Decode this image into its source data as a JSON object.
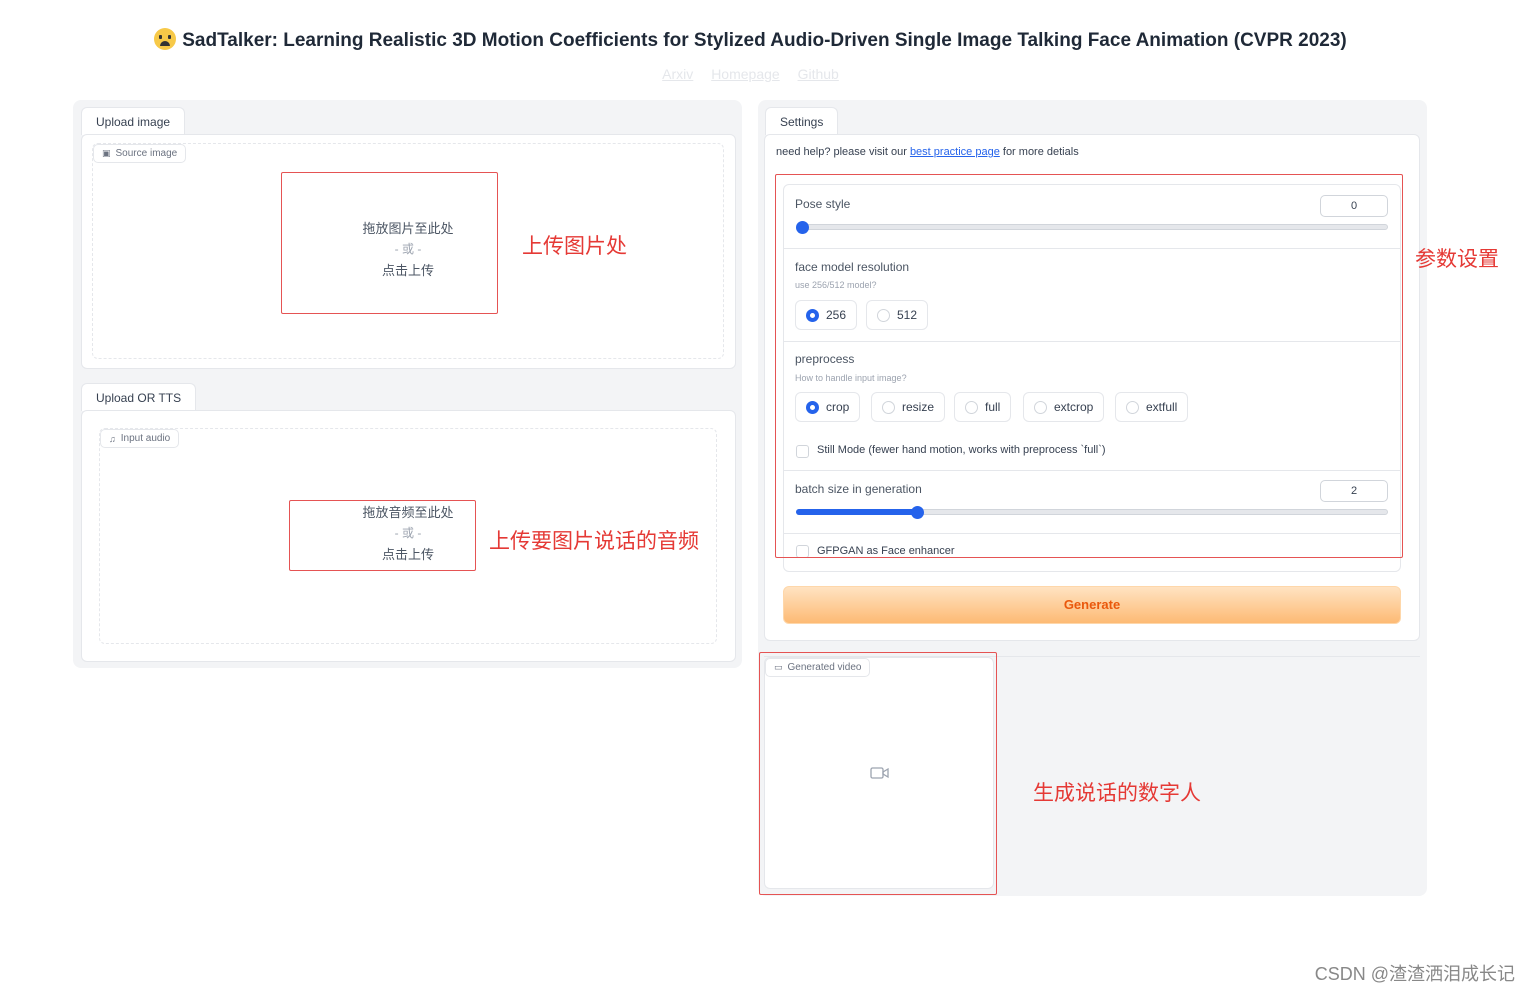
{
  "header": {
    "title": "SadTalker: Learning Realistic 3D Motion Coefficients for Stylized Audio-Driven Single Image Talking Face Animation (CVPR 2023)",
    "links": [
      "Arxiv",
      "Homepage",
      "Github"
    ]
  },
  "upload_image": {
    "tab": "Upload image",
    "chip": "Source image",
    "drop_line1": "拖放图片至此处",
    "drop_or": "- 或 -",
    "drop_line2": "点击上传"
  },
  "upload_audio": {
    "tab": "Upload OR TTS",
    "chip": "Input audio",
    "drop_line1": "拖放音频至此处",
    "drop_or": "- 或 -",
    "drop_line2": "点击上传"
  },
  "settings": {
    "tab": "Settings",
    "help_prefix": "need help? please visit our ",
    "help_link": "best practice page",
    "help_suffix": " for more detials",
    "pose_style": {
      "label": "Pose style",
      "value": "0"
    },
    "face_res": {
      "label": "face model resolution",
      "hint": "use 256/512 model?",
      "options": [
        "256",
        "512"
      ],
      "selected": "256"
    },
    "preprocess": {
      "label": "preprocess",
      "hint": "How to handle input image?",
      "options": [
        "crop",
        "resize",
        "full",
        "extcrop",
        "extfull"
      ],
      "selected": "crop"
    },
    "still_mode": "Still Mode (fewer hand motion, works with preprocess `full`)",
    "batch": {
      "label": "batch size in generation",
      "value": "2"
    },
    "gfpgan": "GFPGAN as Face enhancer",
    "generate": "Generate"
  },
  "output": {
    "chip": "Generated video"
  },
  "annotations": {
    "upload_image": "上传图片处",
    "upload_audio": "上传要图片说话的音频",
    "settings": "参数设置",
    "output": "生成说话的数字人"
  },
  "watermark": "CSDN @渣渣洒泪成长记",
  "colors": {
    "accent": "#2563eb",
    "generate": "#ea580c",
    "annotation": "#e53935"
  }
}
